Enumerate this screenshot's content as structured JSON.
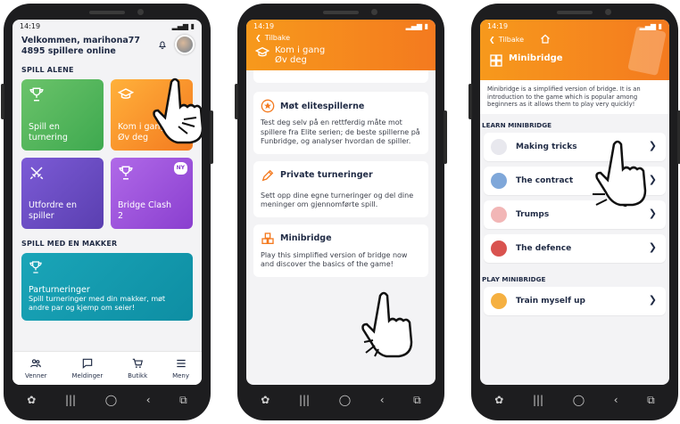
{
  "phone1": {
    "time": "14:19",
    "welcome_line1": "Velkommen, marihona77",
    "welcome_line2": "4895 spillere online",
    "section_alone": "SPILL ALENE",
    "tiles": [
      {
        "label_line1": "Spill en",
        "label_line2": "turnering",
        "icon": "trophy-icon"
      },
      {
        "label_line1": "Kom i gang",
        "label_line2": "Øv deg",
        "icon": "graduation-cap-icon"
      },
      {
        "label_line1": "Utfordre en",
        "label_line2": "spiller",
        "icon": "crossed-swords-icon"
      },
      {
        "label_line1": "Bridge Clash",
        "label_line2": "2",
        "icon": "trophy-icon",
        "badge": "NY"
      }
    ],
    "section_partner": "SPILL MED EN MAKKER",
    "partner_tile": {
      "title": "Parturneringer",
      "text": "Spill turneringer med din makker, møt andre par og kjemp om seier!"
    },
    "tabs": [
      "Venner",
      "Meldinger",
      "Butikk",
      "Meny"
    ]
  },
  "phone2": {
    "time": "14:19",
    "back_label": "Tilbake",
    "header_title_line1": "Kom i gang",
    "header_title_line2": "Øv deg",
    "cards": [
      {
        "title": "Møt elitespillerne",
        "text": "Test deg selv på en rettferdig måte mot spillere fra Elite serien; de beste spillerne på Funbridge, og analyser hvordan de spiller."
      },
      {
        "title": "Private turneringer",
        "text": "Sett opp dine egne turneringer og del dine meninger om gjennomførte spill."
      },
      {
        "title": "Minibridge",
        "text": "Play this simplified version of bridge now and discover the basics of the game!"
      }
    ]
  },
  "phone3": {
    "time": "14:19",
    "back_label": "Tilbake",
    "header_title": "Minibridge",
    "intro": "Minibridge is a simplified version of bridge. It is an introduction to the game which is popular among beginners as it allows them to play very quickly!",
    "section_learn": "LEARN MINIBRIDGE",
    "lessons": [
      "Making tricks",
      "The contract",
      "Trumps",
      "The defence"
    ],
    "section_play": "PLAY MINIBRIDGE",
    "play_item": "Train myself up"
  },
  "colors": {
    "orange": "#f47a1f",
    "green": "#3ea94f",
    "purple": "#5a3fb0",
    "violet": "#8a3fcf",
    "teal": "#0e8ea3",
    "navy": "#1f2a44"
  }
}
